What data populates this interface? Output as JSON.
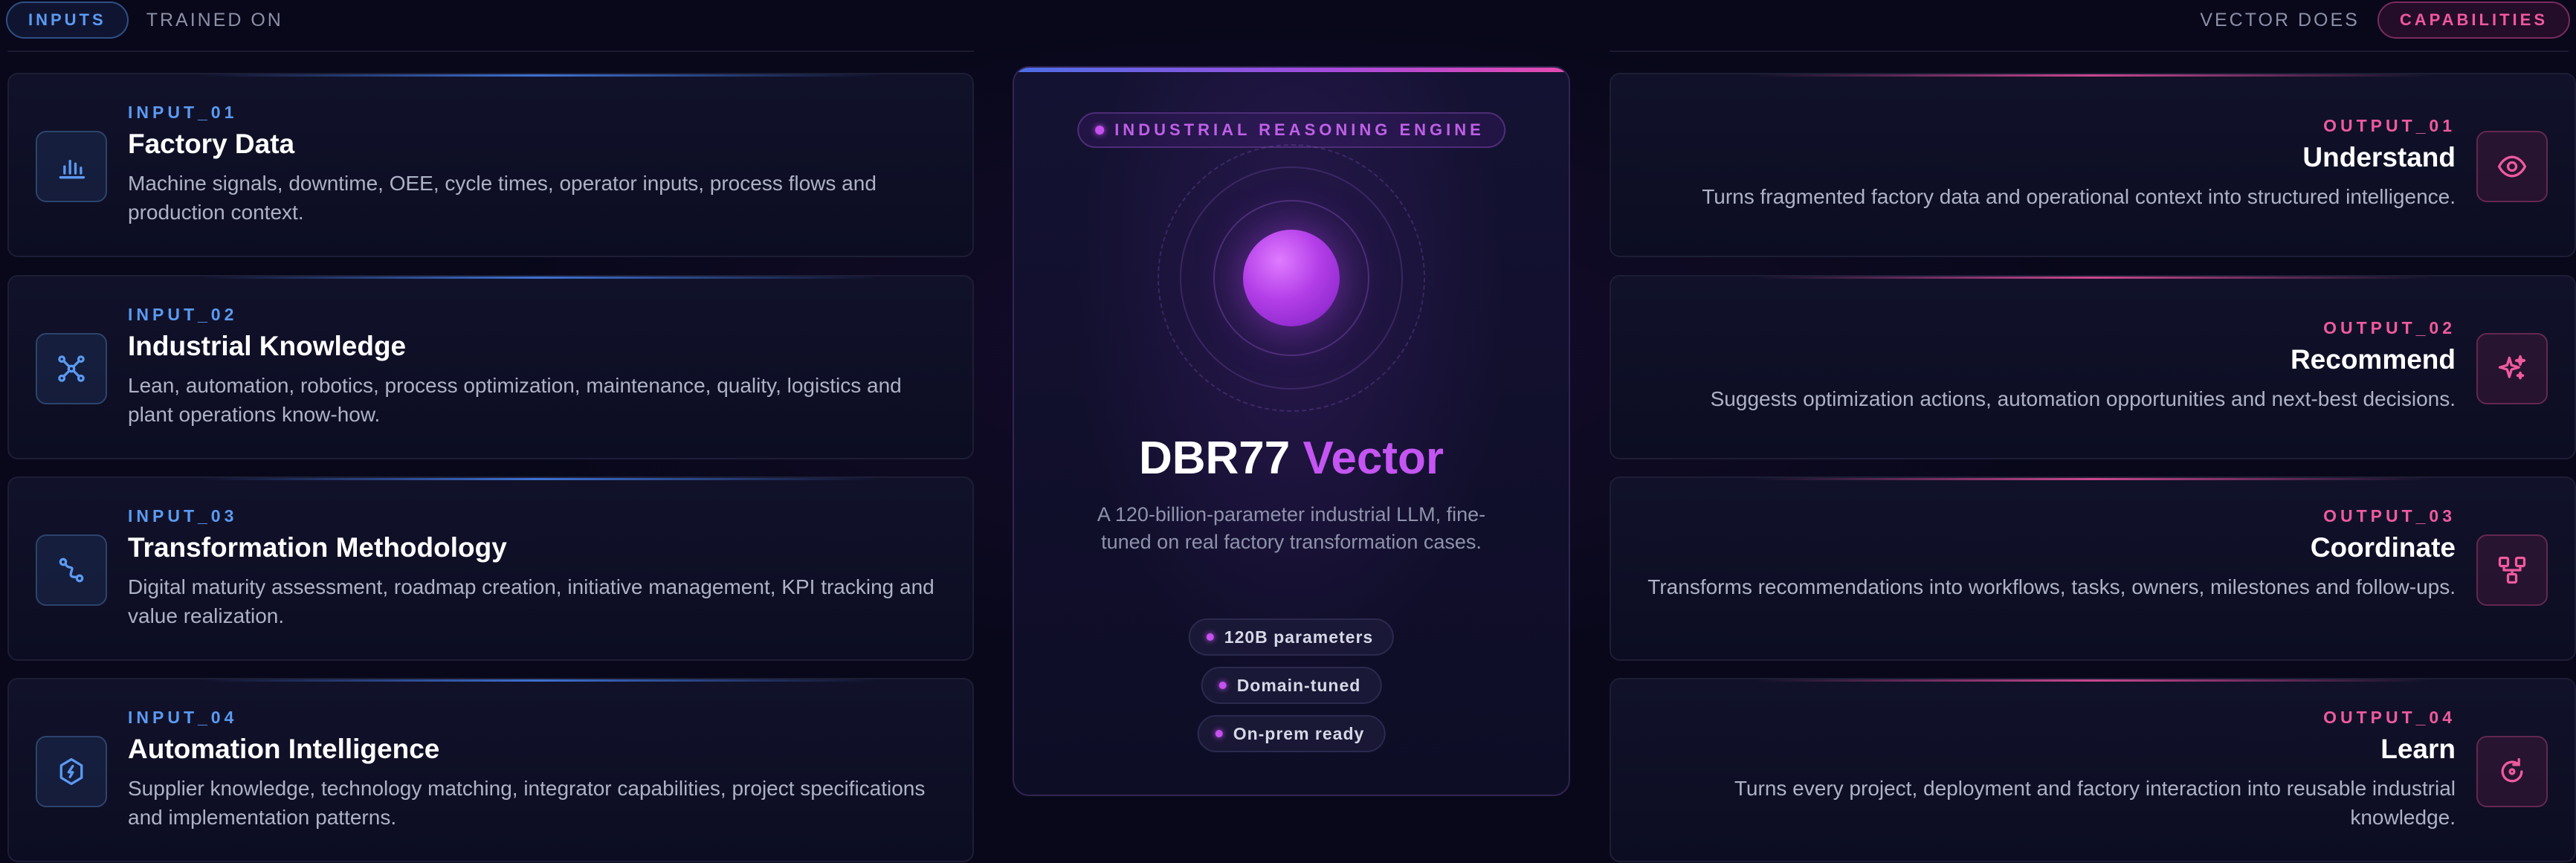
{
  "header": {
    "inputs_pill": "INPUTS",
    "trained_on": "TRAINED ON",
    "vector_does": "VECTOR DOES",
    "capabilities_pill": "CAPABILITIES"
  },
  "inputs": [
    {
      "label": "INPUT_01",
      "title": "Factory Data",
      "description": "Machine signals, downtime, OEE, cycle times, operator inputs, process flows and production context.",
      "icon": "bar-chart-icon"
    },
    {
      "label": "INPUT_02",
      "title": "Industrial Knowledge",
      "description": "Lean, automation, robotics, process optimization, maintenance, quality, logistics and plant operations know-how.",
      "icon": "network-icon"
    },
    {
      "label": "INPUT_03",
      "title": "Transformation Methodology",
      "description": "Digital maturity assessment, roadmap creation, initiative management, KPI tracking and value realization.",
      "icon": "route-icon"
    },
    {
      "label": "INPUT_04",
      "title": "Automation Intelligence",
      "description": "Supplier knowledge, technology matching, integrator capabilities, project specifications and implementation patterns.",
      "icon": "hexagon-bolt-icon"
    }
  ],
  "engine": {
    "badge": "INDUSTRIAL REASONING ENGINE",
    "name_primary": "DBR77",
    "name_accent": "Vector",
    "description": "A 120-billion-parameter industrial LLM, fine-tuned on real factory transformation cases.",
    "chips": [
      "120B parameters",
      "Domain-tuned",
      "On-prem ready"
    ],
    "colors": {
      "accent": "#c455f2",
      "gradient_start": "#4b6fe6",
      "gradient_end": "#e64ab0"
    }
  },
  "outputs": [
    {
      "label": "OUTPUT_01",
      "title": "Understand",
      "description": "Turns fragmented factory data and operational context into structured intelligence.",
      "icon": "eye-icon"
    },
    {
      "label": "OUTPUT_02",
      "title": "Recommend",
      "description": "Suggests optimization actions, automation opportunities and next-best decisions.",
      "icon": "sparkle-icon"
    },
    {
      "label": "OUTPUT_03",
      "title": "Coordinate",
      "description": "Transforms recommendations into workflows, tasks, owners, milestones and follow-ups.",
      "icon": "workflow-icon"
    },
    {
      "label": "OUTPUT_04",
      "title": "Learn",
      "description": "Turns every project, deployment and factory interaction into reusable industrial knowledge.",
      "icon": "refresh-icon"
    }
  ],
  "colors": {
    "input_accent": "#5b9af2",
    "output_accent": "#ef5a9e",
    "background": "#08081a"
  }
}
